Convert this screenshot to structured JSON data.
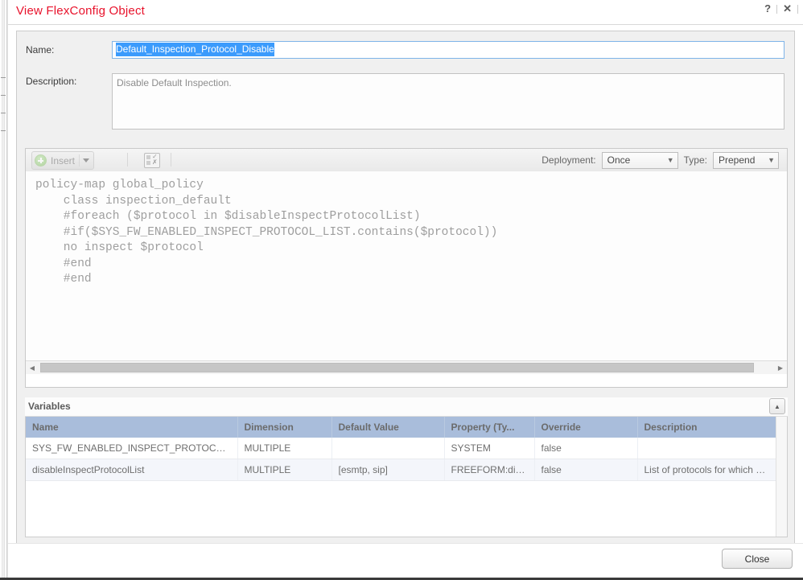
{
  "window": {
    "title": "View FlexConfig Object",
    "help_icon": "question-mark-icon",
    "close_icon": "close-x-icon"
  },
  "form": {
    "name_label": "Name:",
    "name_value": "Default_Inspection_Protocol_Disable",
    "description_label": "Description:",
    "description_value": "Disable Default Inspection."
  },
  "editor": {
    "insert_label": "Insert",
    "insert_caret": "▼",
    "grid_icon": "variable-table-icon",
    "deployment_label": "Deployment:",
    "deployment_value": "Once",
    "type_label": "Type:",
    "type_value": "Prepend",
    "dropdown_arrow": "▼",
    "code": "policy-map global_policy\n    class inspection_default\n    #foreach ($protocol in $disableInspectProtocolList)\n    #if($SYS_FW_ENABLED_INSPECT_PROTOCOL_LIST.contains($protocol))\n    no inspect $protocol\n    #end\n    #end",
    "scroll_left_arrow": "◀",
    "scroll_right_arrow": "▶"
  },
  "variables": {
    "section_title": "Variables",
    "collapse_icon": "▲",
    "columns": [
      "Name",
      "Dimension",
      "Default Value",
      "Property (Ty...",
      "Override",
      "Description"
    ],
    "rows": [
      {
        "name": "SYS_FW_ENABLED_INSPECT_PROTOCOL...",
        "dimension": "MULTIPLE",
        "default_value": "",
        "property": "SYSTEM",
        "override": "false",
        "description": ""
      },
      {
        "name": "disableInspectProtocolList",
        "dimension": "MULTIPLE",
        "default_value": "[esmtp, sip]",
        "property": "FREEFORM:dis...",
        "override": "false",
        "description": "List of protocols for which default..."
      }
    ]
  },
  "footer": {
    "close_label": "Close"
  },
  "colors": {
    "title_red": "#e8122b",
    "selection_blue": "#3b9bfc",
    "table_header_blue": "#a9bddb",
    "code_gray": "#9e9e9e"
  }
}
